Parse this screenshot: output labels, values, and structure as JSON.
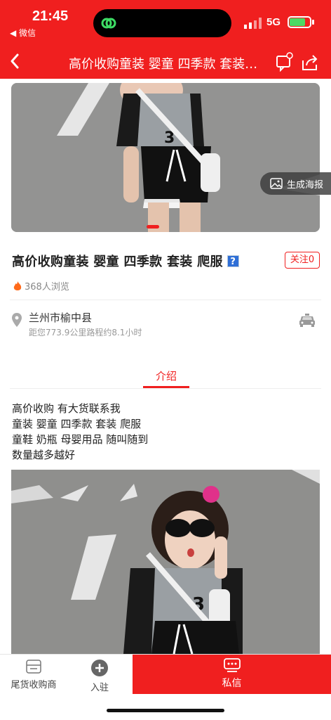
{
  "status_bar": {
    "time": "21:45",
    "back_app": "◀ 微信",
    "network": "5G"
  },
  "nav": {
    "title": "高价收购童装 婴童 四季款 套装…"
  },
  "banner": {
    "poster_label": "生成海报"
  },
  "product": {
    "title": "高价收购童装 婴童 四季款 套装 爬服",
    "badge": "?",
    "follow_label": "关注0",
    "views": "368人浏览"
  },
  "location": {
    "name": "兰州市榆中县",
    "distance": "距您773.9公里路程约8.1小时"
  },
  "tabs": [
    {
      "label": "介绍"
    }
  ],
  "description": [
    "高价收购 有大货联系我",
    "童装 婴童 四季款 套装 爬服",
    "童鞋 奶瓶 母婴用品 随叫随到",
    "数量越多越好"
  ],
  "bottom_bar": {
    "shop_label": "尾货收购商",
    "join_label": "入驻",
    "chat_label": "私信"
  },
  "colors": {
    "brand_red": "#f01f1f",
    "battery_green": "#4cd964"
  },
  "icons": [
    "chevron-left-icon",
    "service-icon",
    "share-icon",
    "image-icon",
    "fire-icon",
    "location-pin-icon",
    "taxi-icon",
    "store-icon",
    "plus-icon",
    "chat-icon"
  ]
}
